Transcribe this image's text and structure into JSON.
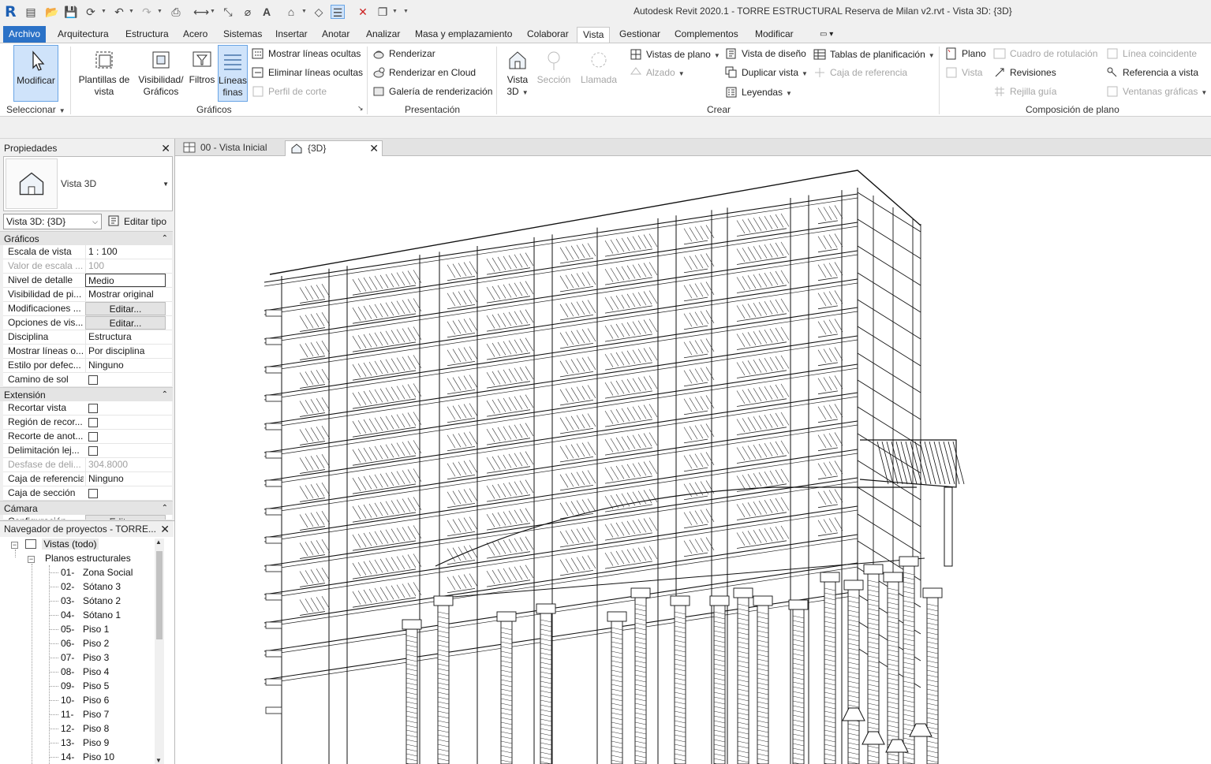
{
  "window": {
    "title": "Autodesk Revit 2020.1 - TORRE ESTRUCTURAL Reserva de Milan v2.rvt - Vista 3D: {3D}",
    "logo_letter": "R"
  },
  "ribbon_tabs": [
    "Archivo",
    "Arquitectura",
    "Estructura",
    "Acero",
    "Sistemas",
    "Insertar",
    "Anotar",
    "Analizar",
    "Masa y emplazamiento",
    "Colaborar",
    "Vista",
    "Gestionar",
    "Complementos",
    "Modificar"
  ],
  "active_tab": "Vista",
  "ribbon": {
    "seleccionar": {
      "modify_label": "Modificar",
      "panel_title": "Seleccionar"
    },
    "graficos": {
      "panel_title": "Gráficos",
      "plantillas": "Plantillas de vista",
      "visibilidad": "Visibilidad/ Gráficos",
      "filtros": "Filtros",
      "lineas_finas": "Líneas finas",
      "mostrar_ocultas": "Mostrar líneas ocultas",
      "eliminar_ocultas": "Eliminar líneas ocultas",
      "perfil_corte": "Perfil de corte"
    },
    "presentacion": {
      "panel_title": "Presentación",
      "renderizar": "Renderizar",
      "renderizar_cloud": "Renderizar  en Cloud",
      "galeria": "Galería de  renderización"
    },
    "crear": {
      "panel_title": "Crear",
      "vista3d": "Vista 3D",
      "seccion": "Sección",
      "llamada": "Llamada",
      "vistas_plano": "Vistas de plano",
      "alzado": "Alzado",
      "vista_diseno": "Vista de diseño",
      "duplicar_vista": "Duplicar vista",
      "leyendas": "Leyendas",
      "tablas": "Tablas de planificación",
      "caja_referencia": "Caja de referencia"
    },
    "composicion": {
      "panel_title": "Composición de plano",
      "plano": "Plano",
      "vista": "Vista",
      "cuadro_rotulacion": "Cuadro de rotulación",
      "revisiones": "Revisiones",
      "rejilla_guia": "Rejilla guía",
      "linea_coincidente": "Línea coincidente",
      "referencia_vista": "Referencia a vista",
      "ventanas_graficas": "Ventanas gráficas"
    }
  },
  "properties": {
    "header": "Propiedades",
    "type_name": "Vista 3D",
    "view_selector": "Vista 3D: {3D}",
    "edit_type": "Editar tipo",
    "groups": {
      "graficos": "Gráficos",
      "extension": "Extensión",
      "camara": "Cámara"
    },
    "graficos_rows": [
      {
        "k": "Escala de vista",
        "v": "1 : 100",
        "kind": "text"
      },
      {
        "k": "Valor de escala ...",
        "v": "100",
        "kind": "dim"
      },
      {
        "k": "Nivel de detalle",
        "v": "Medio",
        "kind": "field"
      },
      {
        "k": "Visibilidad de pi...",
        "v": "Mostrar original",
        "kind": "text"
      },
      {
        "k": "Modificaciones ...",
        "v": "Editar...",
        "kind": "btn"
      },
      {
        "k": "Opciones de vis...",
        "v": "Editar...",
        "kind": "btn"
      },
      {
        "k": "Disciplina",
        "v": "Estructura",
        "kind": "text"
      },
      {
        "k": "Mostrar líneas o...",
        "v": "Por disciplina",
        "kind": "text"
      },
      {
        "k": "Estilo por defec...",
        "v": "Ninguno",
        "kind": "text"
      },
      {
        "k": "Camino de sol",
        "v": "",
        "kind": "check"
      }
    ],
    "extension_rows": [
      {
        "k": "Recortar vista",
        "v": "",
        "kind": "check"
      },
      {
        "k": "Región de recor...",
        "v": "",
        "kind": "check"
      },
      {
        "k": "Recorte de anot...",
        "v": "",
        "kind": "check"
      },
      {
        "k": "Delimitación lej...",
        "v": "",
        "kind": "check"
      },
      {
        "k": "Desfase de deli...",
        "v": "304.8000",
        "kind": "dim"
      },
      {
        "k": "Caja de referencia",
        "v": "Ninguno",
        "kind": "text"
      },
      {
        "k": "Caja de sección",
        "v": "",
        "kind": "check"
      }
    ],
    "camara_rows": [
      {
        "k": "Configuración ...",
        "v": "Editar...",
        "kind": "btn"
      }
    ]
  },
  "browser": {
    "header": "Navegador de proyectos - TORRE...",
    "root": "Vistas (todo)",
    "folder": "Planos estructurales",
    "items": [
      {
        "num": "01-",
        "name": "Zona Social"
      },
      {
        "num": "02-",
        "name": "Sótano 3"
      },
      {
        "num": "03-",
        "name": "Sótano 2"
      },
      {
        "num": "04-",
        "name": "Sótano 1"
      },
      {
        "num": "05-",
        "name": "Piso 1"
      },
      {
        "num": "06-",
        "name": "Piso 2"
      },
      {
        "num": "07-",
        "name": "Piso 3"
      },
      {
        "num": "08-",
        "name": "Piso 4"
      },
      {
        "num": "09-",
        "name": "Piso 5"
      },
      {
        "num": "10-",
        "name": "Piso 6"
      },
      {
        "num": "11-",
        "name": "Piso 7"
      },
      {
        "num": "12-",
        "name": "Piso 8"
      },
      {
        "num": "13-",
        "name": "Piso 9"
      },
      {
        "num": "14-",
        "name": "Piso 10"
      }
    ]
  },
  "view_tabs": [
    {
      "label": "00 - Vista Inicial",
      "active": false
    },
    {
      "label": "{3D}",
      "active": true
    }
  ],
  "colors": {
    "accent": "#2b72c7",
    "selected_bg": "#cfe3fa",
    "chrome": "#f0f0f0"
  }
}
